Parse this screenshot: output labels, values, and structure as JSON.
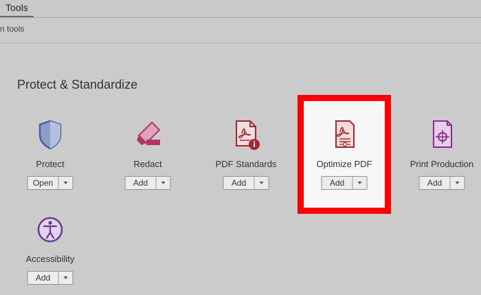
{
  "header": {
    "tab_label": "Tools"
  },
  "search": {
    "partial_text": "n tools"
  },
  "section": {
    "title": "Protect & Standardize"
  },
  "colors": {
    "highlight_border": "#ff0000",
    "protect_icon": "#4a5fa0",
    "redact_icon": "#b2356a",
    "pdf_icon": "#a6262d",
    "print_icon": "#8a2c8c",
    "accessibility_icon": "#6a3a8c"
  },
  "tools": [
    {
      "label": "Protect",
      "button": "Open",
      "icon": "shield-icon"
    },
    {
      "label": "Redact",
      "button": "Add",
      "icon": "redact-marker-icon"
    },
    {
      "label": "PDF Standards",
      "button": "Add",
      "icon": "pdf-standards-icon"
    },
    {
      "label": "Optimize PDF",
      "button": "Add",
      "icon": "optimize-pdf-icon",
      "highlighted": true
    },
    {
      "label": "Print Production",
      "button": "Add",
      "icon": "print-production-icon"
    },
    {
      "label": "Accessibility",
      "button": "Add",
      "icon": "accessibility-icon"
    }
  ]
}
